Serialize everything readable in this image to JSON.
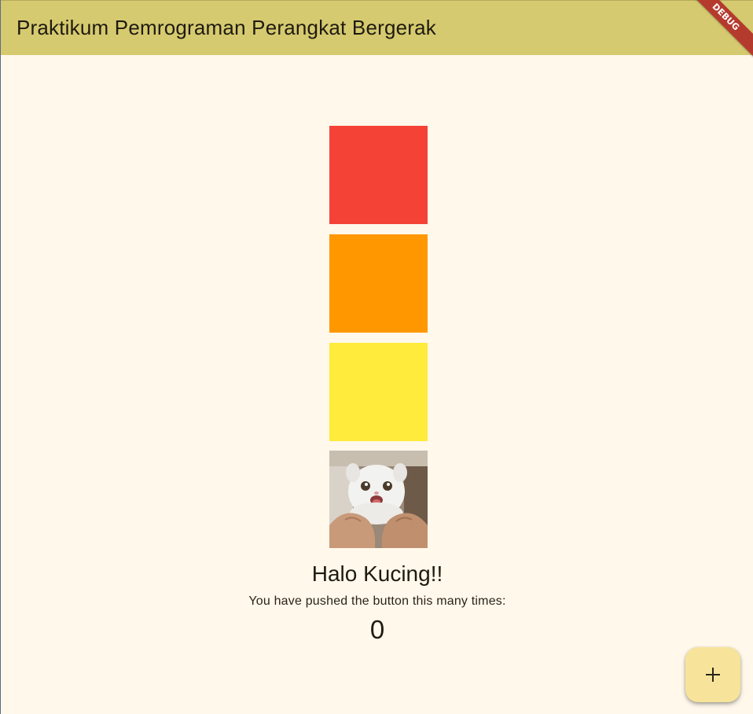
{
  "appbar": {
    "title": "Praktikum Pemrograman Perangkat Bergerak",
    "background_color": "#d6ca70"
  },
  "debug_banner": {
    "label": "DEBUG",
    "color": "#b53a2e"
  },
  "page": {
    "background_color": "#fff8eb"
  },
  "boxes": [
    {
      "name": "red",
      "color": "#f44336"
    },
    {
      "name": "orange",
      "color": "#ff9800"
    },
    {
      "name": "yellow",
      "color": "#ffeb3b"
    }
  ],
  "cat_image": {
    "icon": "cat-photo"
  },
  "greeting": "Halo Kucing!!",
  "counter": {
    "label": "You have pushed the button this many times:",
    "value": "0"
  },
  "fab": {
    "icon": "plus-icon",
    "color": "#f7e49a"
  }
}
